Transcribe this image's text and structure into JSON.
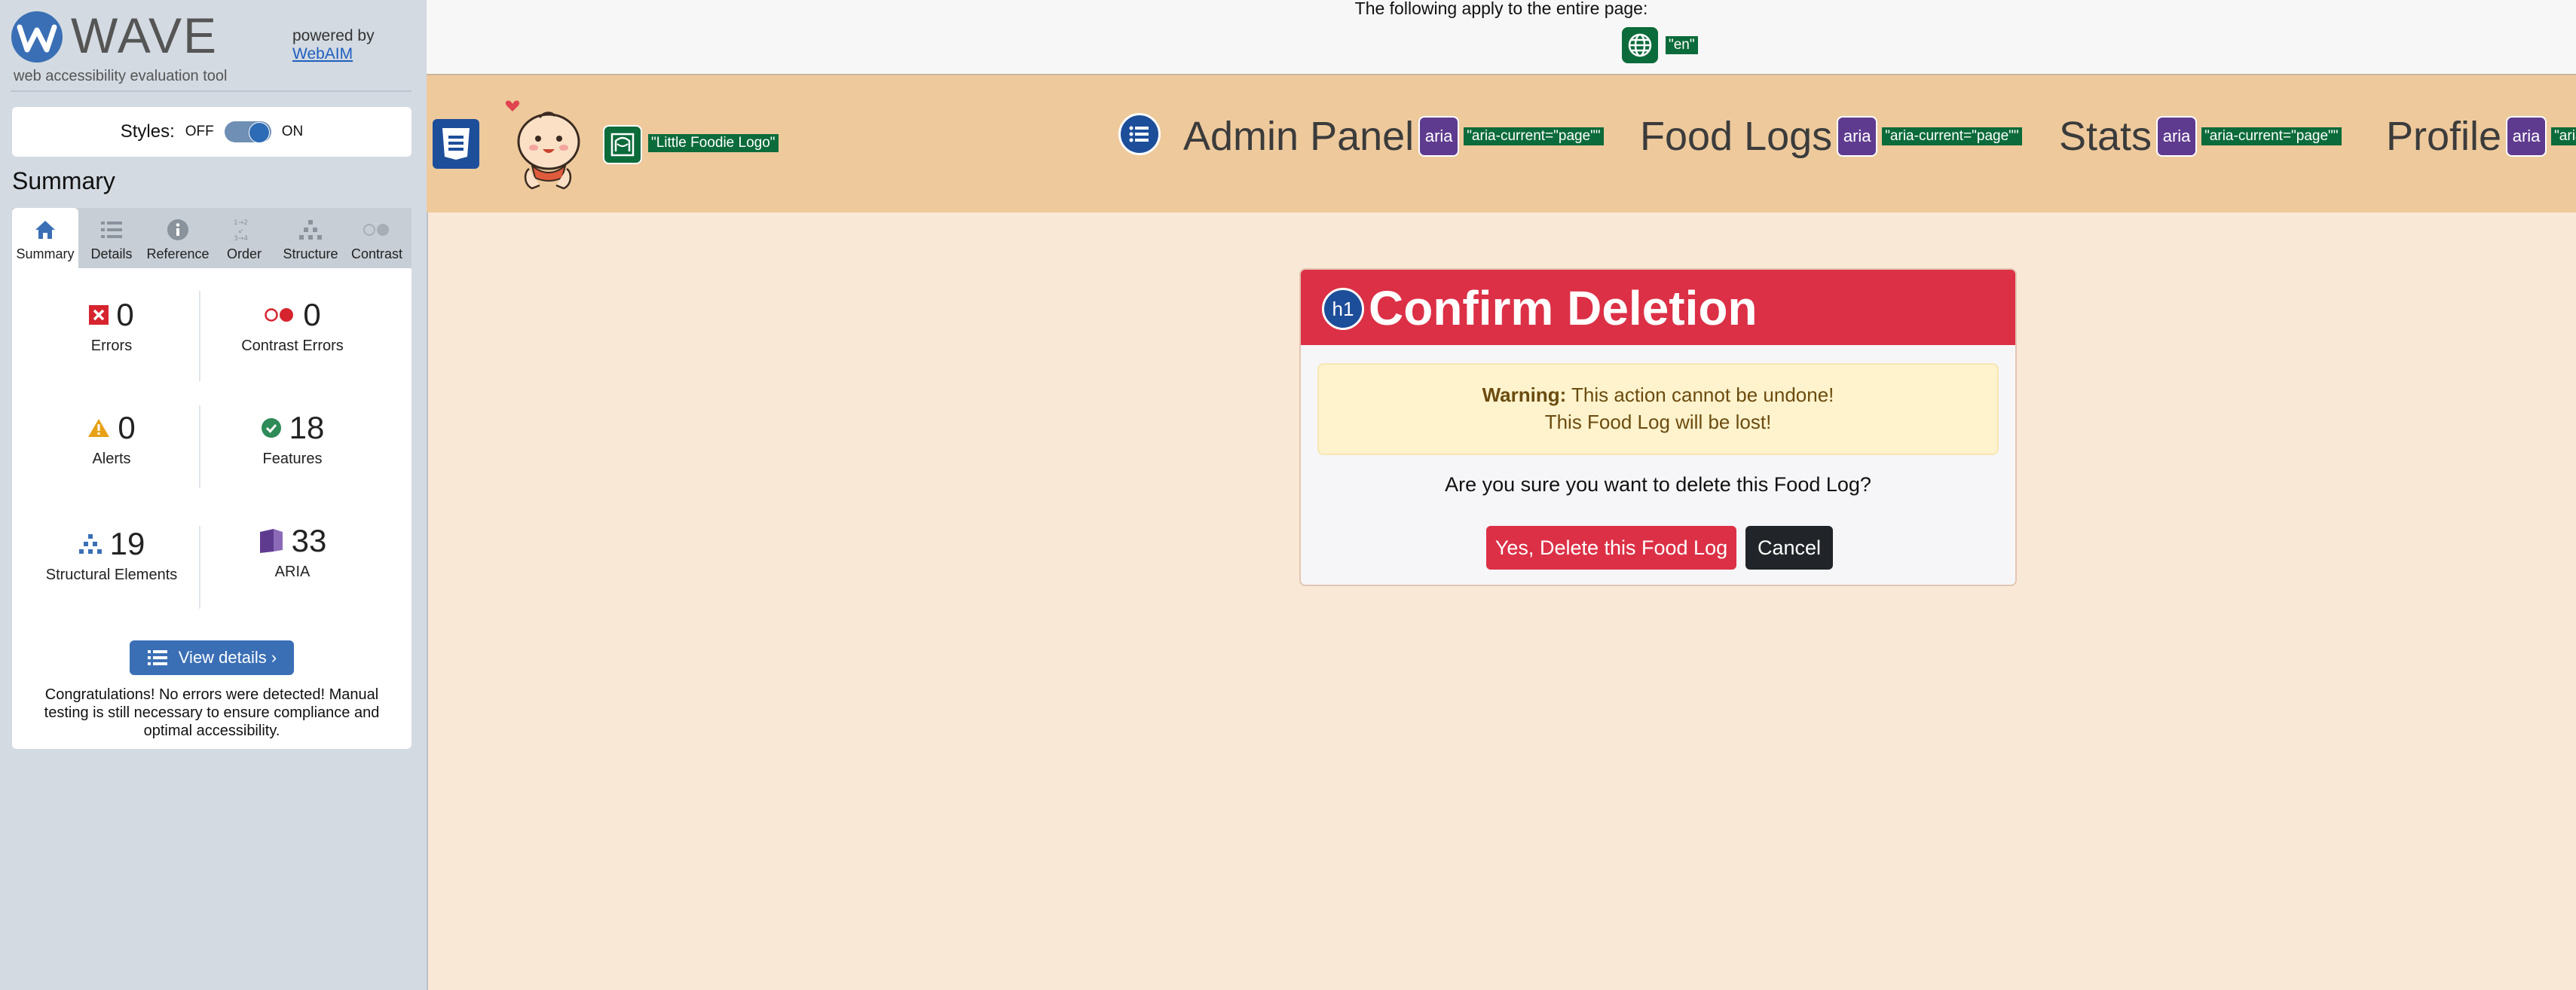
{
  "wave": {
    "name": "WAVE",
    "subtitle": "web accessibility evaluation tool",
    "powered_by": "powered by",
    "webaim_link": "WebAIM",
    "styles_label": "Styles:",
    "styles_off": "OFF",
    "styles_on": "ON",
    "styles_enabled": true,
    "summary_title": "Summary",
    "tabs": [
      {
        "label": "Summary",
        "icon": "home-icon",
        "active": true
      },
      {
        "label": "Details",
        "icon": "list-icon",
        "active": false
      },
      {
        "label": "Reference",
        "icon": "info-icon",
        "active": false
      },
      {
        "label": "Order",
        "icon": "order-icon",
        "active": false
      },
      {
        "label": "Structure",
        "icon": "structure-icon",
        "active": false
      },
      {
        "label": "Contrast",
        "icon": "contrast-icon",
        "active": false
      }
    ],
    "stats": {
      "errors": {
        "value": "0",
        "label": "Errors"
      },
      "contrast_errors": {
        "value": "0",
        "label": "Contrast Errors"
      },
      "alerts": {
        "value": "0",
        "label": "Alerts"
      },
      "features": {
        "value": "18",
        "label": "Features"
      },
      "structural": {
        "value": "19",
        "label": "Structural Elements"
      },
      "aria": {
        "value": "33",
        "label": "ARIA"
      }
    },
    "view_details": "View details ›",
    "congrats": "Congratulations! No errors were detected! Manual testing is still necessary to ensure compliance and optimal accessibility."
  },
  "page": {
    "top_notice": "The following apply to the entire page:",
    "lang_tag": "\"en\"",
    "logo_alt_tag": "\"Little Foodie Logo\"",
    "nav": [
      {
        "label": "Admin Panel",
        "aria_tag": "\"aria-current=\"page\"\""
      },
      {
        "label": "Food Logs",
        "aria_tag": "\"aria-current=\"page\"\""
      },
      {
        "label": "Stats",
        "aria_tag": "\"aria-current=\"page\"\""
      },
      {
        "label": "Profile",
        "aria_tag": "\"aria"
      }
    ],
    "aria_badge": "aria",
    "h1_badge": "h1",
    "card": {
      "title": "Confirm Deletion",
      "warning_strong": "Warning:",
      "warning_text": " This action cannot be undone!",
      "warning_line2": "This Food Log will be lost!",
      "question": "Are you sure you want to delete this Food Log?",
      "delete_button": "Yes, Delete this Food Log",
      "cancel_button": "Cancel"
    }
  },
  "colors": {
    "wave_blue": "#3a6fb5",
    "navbar_bg": "#edc99c",
    "page_bg": "#fae8d6",
    "danger": "#dc3046",
    "aria_purple": "#5f3b8f",
    "wave_green": "#0c6b3a"
  }
}
